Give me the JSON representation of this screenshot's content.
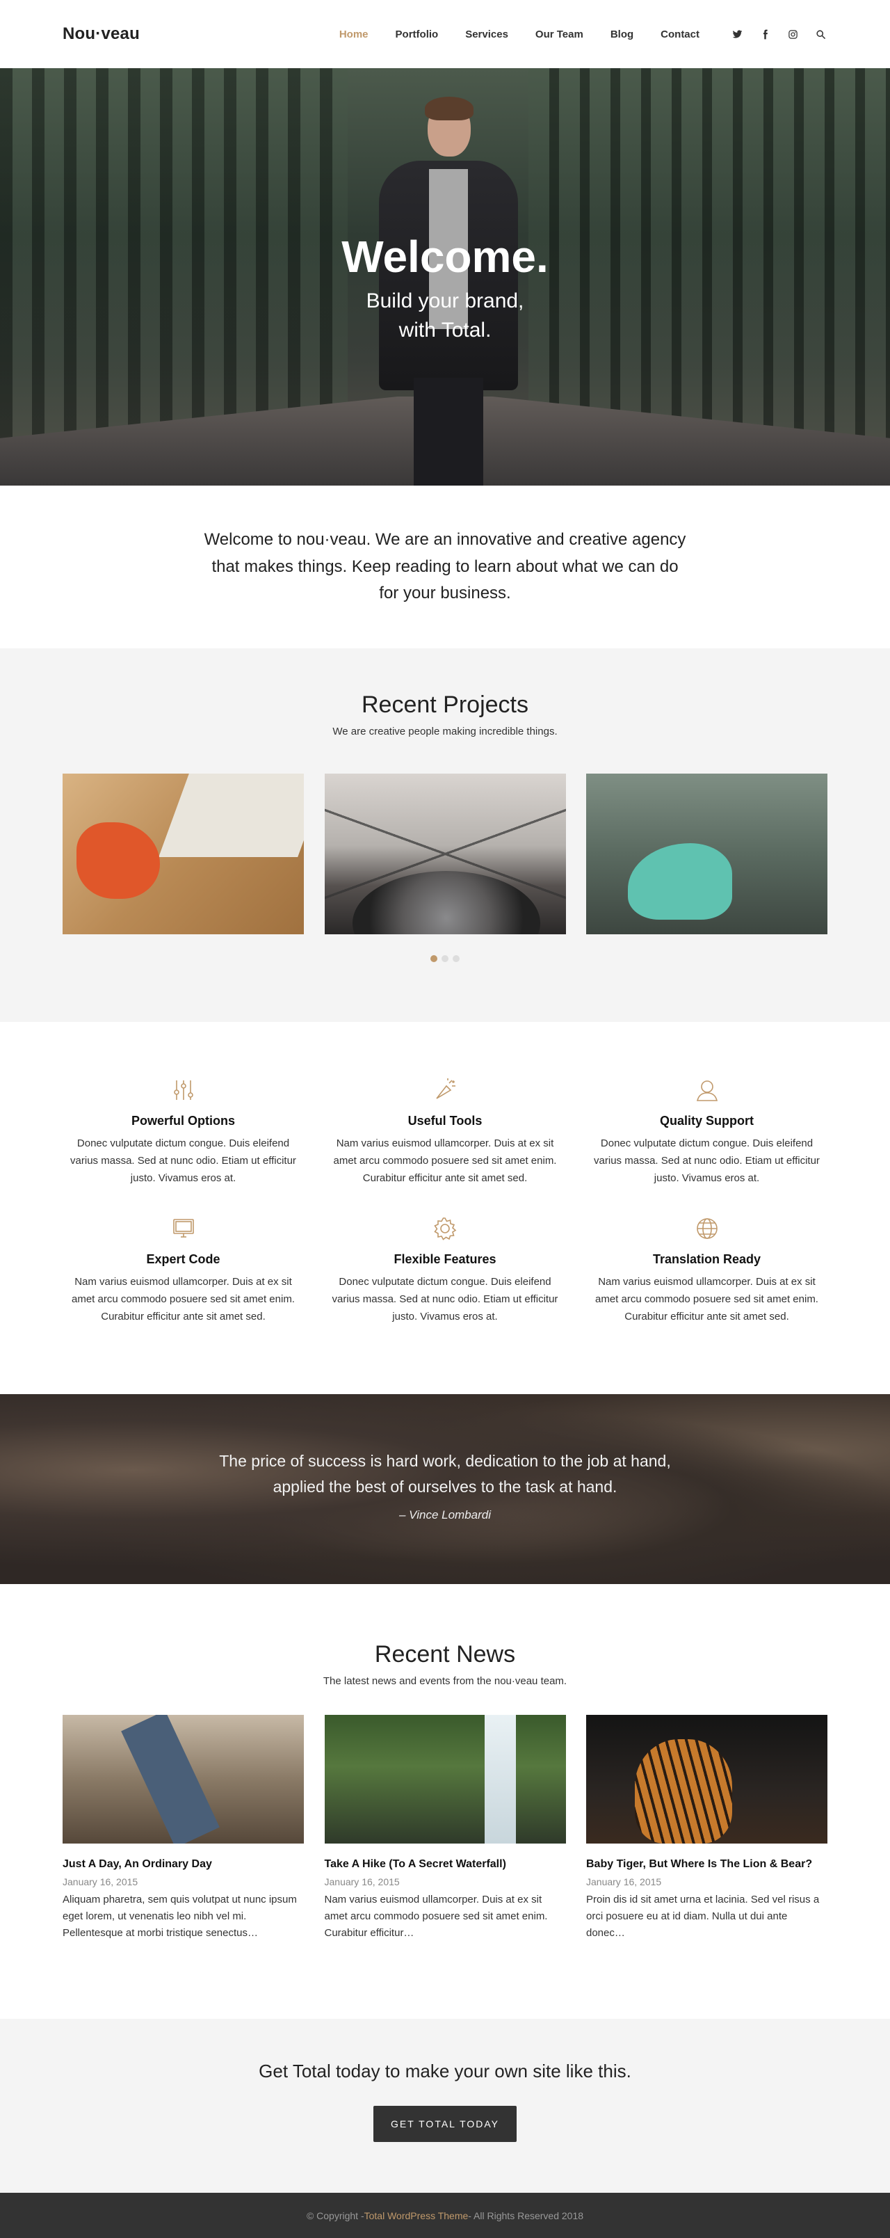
{
  "header": {
    "logo": "Nou·veau",
    "nav": [
      "Home",
      "Portfolio",
      "Services",
      "Our Team",
      "Blog",
      "Contact"
    ],
    "social_icons": [
      "twitter-icon",
      "facebook-icon",
      "instagram-icon",
      "search-icon"
    ],
    "accent_color": "#c0996b"
  },
  "hero": {
    "title": "Welcome.",
    "subtitle_line1": "Build your brand,",
    "subtitle_line2": "with Total."
  },
  "intro": {
    "text": "Welcome to nou·veau. We are an innovative and creative agency that makes things. Keep reading to learn about what we can do for your business."
  },
  "projects": {
    "title": "Recent Projects",
    "subtitle": "We are creative people making incredible things."
  },
  "features": [
    {
      "title": "Powerful Options",
      "text": "Donec vulputate dictum congue. Duis eleifend varius massa. Sed at nunc odio. Etiam ut efficitur justo. Vivamus eros at.",
      "icon": "sliders-icon"
    },
    {
      "title": "Useful Tools",
      "text": "Nam varius euismod ullamcorper. Duis at ex sit amet arcu commodo posuere sed sit amet enim. Curabitur efficitur ante sit amet sed.",
      "icon": "magic-wand-icon"
    },
    {
      "title": "Quality Support",
      "text": "Donec vulputate dictum congue. Duis eleifend varius massa. Sed at nunc odio. Etiam ut efficitur justo. Vivamus eros at.",
      "icon": "user-icon"
    },
    {
      "title": "Expert Code",
      "text": "Nam varius euismod ullamcorper. Duis at ex sit amet arcu commodo posuere sed sit amet enim. Curabitur efficitur ante sit amet sed.",
      "icon": "monitor-icon"
    },
    {
      "title": "Flexible Features",
      "text": "Donec vulputate dictum congue. Duis eleifend varius massa. Sed at nunc odio. Etiam ut efficitur justo. Vivamus eros at.",
      "icon": "gear-icon"
    },
    {
      "title": "Translation Ready",
      "text": "Nam varius euismod ullamcorper. Duis at ex sit amet arcu commodo posuere sed sit amet enim. Curabitur efficitur ante sit amet sed.",
      "icon": "globe-icon"
    }
  ],
  "quote": {
    "text": "The price of success is hard work, dedication to the job at hand, applied the best of ourselves to the task at hand.",
    "author": "– Vince Lombardi"
  },
  "news": {
    "title": "Recent News",
    "subtitle": "The latest news and events from the nou·veau team.",
    "posts": [
      {
        "title": "Just A Day, An Ordinary Day",
        "date": "January 16, 2015",
        "excerpt": "Aliquam pharetra, sem quis volutpat ut nunc ipsum eget lorem, ut venenatis leo nibh vel mi. Pellentesque at morbi tristique senectus…"
      },
      {
        "title": "Take A Hike (To A Secret Waterfall)",
        "date": "January 16, 2015",
        "excerpt": "Nam varius euismod ullamcorper. Duis at ex sit amet arcu commodo posuere sed sit amet enim. Curabitur efficitur…"
      },
      {
        "title": "Baby Tiger, But Where Is The Lion & Bear?",
        "date": "January 16, 2015",
        "excerpt": "Proin dis id sit amet urna et lacinia. Sed vel risus a orci posuere eu at id diam. Nulla ut dui ante donec…"
      }
    ]
  },
  "cta": {
    "title": "Get Total today to make your own site like this.",
    "button": "GET TOTAL TODAY"
  },
  "footer": {
    "prefix": "© Copyright - ",
    "link": "Total WordPress Theme",
    "suffix": " - All Rights Reserved 2018"
  }
}
